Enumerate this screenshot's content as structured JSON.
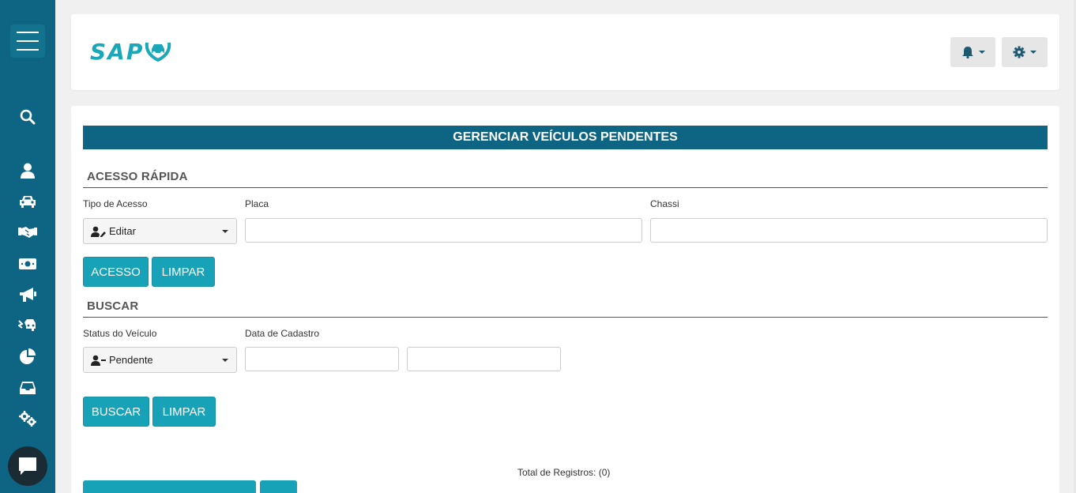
{
  "brand": {
    "logo_text": "SAP",
    "accent_color": "#17a2b8",
    "sidebar_color": "#0e6583"
  },
  "sidebar": {
    "items": [
      {
        "icon": "menu-icon"
      },
      {
        "icon": "search-icon"
      },
      {
        "icon": "user-icon"
      },
      {
        "icon": "car-icon"
      },
      {
        "icon": "handshake-icon"
      },
      {
        "icon": "money-icon"
      },
      {
        "icon": "megaphone-icon"
      },
      {
        "icon": "car-crash-icon"
      },
      {
        "icon": "pie-chart-icon"
      },
      {
        "icon": "inbox-icon"
      },
      {
        "icon": "cogs-icon"
      },
      {
        "icon": "chat-icon"
      }
    ]
  },
  "header": {
    "notification_icon": "bell-icon",
    "settings_icon": "gear-icon"
  },
  "page": {
    "title": "GERENCIAR VEÍCULOS PENDENTES",
    "quick_access": {
      "section_title": "ACESSO RÁPIDA",
      "tipo_label": "Tipo de Acesso",
      "tipo_value": "Editar",
      "placa_label": "Placa",
      "placa_value": "",
      "chassi_label": "Chassi",
      "chassi_value": "",
      "acesso_button": "ACESSO",
      "limpar_button": "LIMPAR"
    },
    "search": {
      "section_title": "BUSCAR",
      "status_label": "Status do Veículo",
      "status_value": "Pendente",
      "data_label": "Data de Cadastro",
      "data_from": "",
      "data_to": "",
      "buscar_button": "BUSCAR",
      "limpar_button": "LIMPAR"
    },
    "total_label": "Total de Registros: (0)"
  }
}
